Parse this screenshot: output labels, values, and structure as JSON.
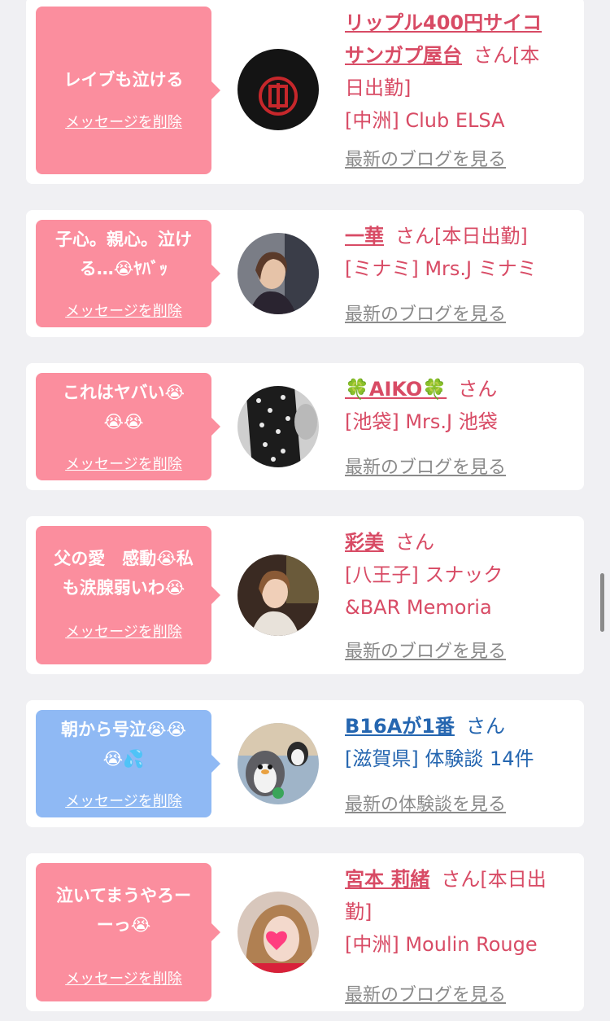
{
  "delete_label": "メッセージを削除",
  "honorific": "さん",
  "cards": [
    {
      "message": "レイブも泣ける",
      "name_line1": "リップル400円サイコ",
      "name_line2": "サンガプ屋台",
      "suffix_line2": "さん[本",
      "suffix_line3": "日出勤]",
      "shop": "[中洲] Club ELSA",
      "more": "最新のブログを見る",
      "avatar_icon": "seal-stamp-avatar"
    },
    {
      "message_line1": "子心。親心。泣け",
      "message_line2": "る…😭ﾔﾊﾞｯ",
      "name": "一華",
      "suffix": "さん[本日出勤]",
      "shop": "[ミナミ] Mrs.J ミナミ",
      "more": "最新のブログを見る",
      "avatar_icon": "woman-portrait-avatar"
    },
    {
      "message_line1": "これはヤバい😭",
      "message_line2": "😭😭",
      "name": "🍀AIKO🍀",
      "suffix": "さん",
      "shop": "[池袋] Mrs.J 池袋",
      "more": "最新のブログを見る",
      "avatar_icon": "dress-avatar"
    },
    {
      "message_line1": "父の愛　感動😭私",
      "message_line2": "も涙腺弱いわ😭",
      "name": "彩美",
      "suffix": "さん",
      "shop_line1": "[八王子] スナック",
      "shop_line2": "&BAR Memoria",
      "more": "最新のブログを見る",
      "avatar_icon": "woman-portrait-avatar"
    },
    {
      "message_line1": "朝から号泣😭😭",
      "message_line2": "😭💦",
      "name": "B16Aが1番",
      "suffix": "さん",
      "shop": "[滋賀県] 体験談 14件",
      "more": "最新の体験談を見る",
      "avatar_icon": "penguin-avatar"
    },
    {
      "message_line1": "泣いてまうやろー",
      "message_line2": "ーっ😭",
      "name": "宮本 莉緒",
      "suffix_line1": "さん[本日出",
      "suffix_line2": "勤]",
      "shop": "[中洲] Moulin Rouge",
      "more": "最新のブログを見る",
      "avatar_icon": "heart-face-avatar"
    }
  ]
}
